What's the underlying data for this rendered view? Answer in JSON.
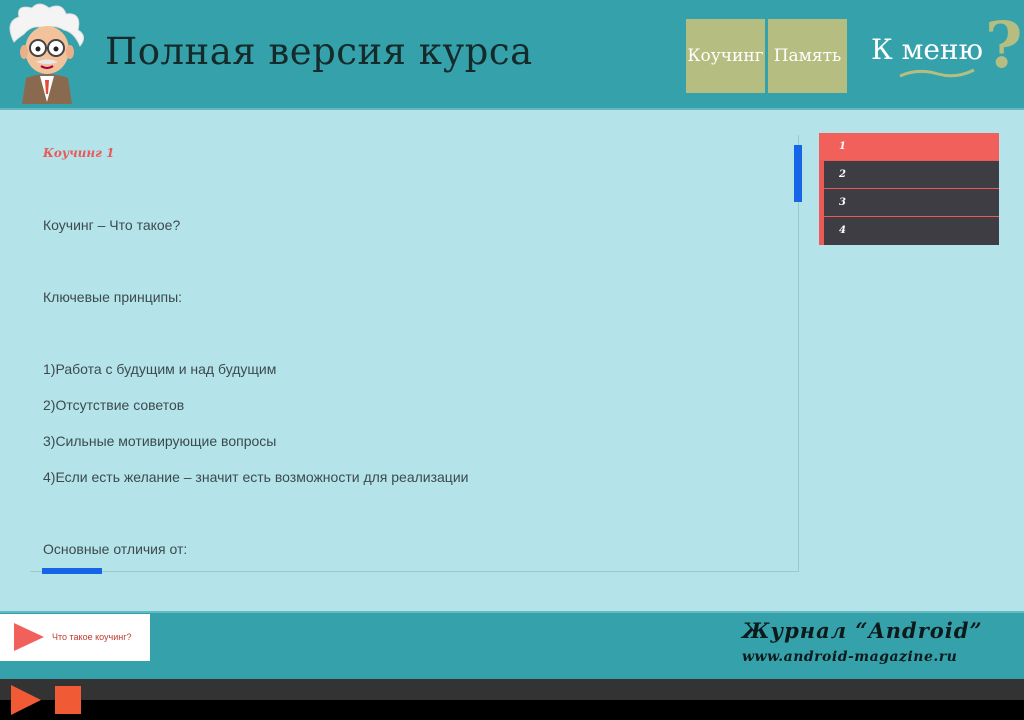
{
  "header": {
    "title": "Полная версия курса",
    "nav": {
      "coaching_label": "Коучинг",
      "memory_label": "Память"
    },
    "to_menu_label": "К меню",
    "help_label": "?"
  },
  "content": {
    "paragraphs": [
      "Коучинг 1",
      "Коучинг – Что такое?",
      "Ключевые принципы:",
      "1)Работа с будущим и над будущим",
      "2)Отсутствие советов",
      "3)Сильные мотивирующие вопросы",
      "4)Если есть желание – значит есть возможности для реализации",
      "Основные отличия от:"
    ]
  },
  "sidelist": {
    "items": [
      "1",
      "2",
      "3",
      "4"
    ],
    "active_index": 0
  },
  "footer": {
    "audio_label": "Что такое коучинг?",
    "magazine_line1": "Журнал “Android”",
    "magazine_line2": "www.android-magazine.ru"
  },
  "colors": {
    "header_bg": "#35a2ab",
    "content_bg": "#b4e4ea",
    "nav_button": "#b5be80",
    "accent_red": "#f2605c",
    "scroll_blue": "#1565e6",
    "player_orange": "#f05a35"
  },
  "icons": {
    "mascot": "einstein-mascot-icon",
    "help": "question-mark-icon",
    "audio_play": "play-icon",
    "player_play": "play-icon",
    "player_stop": "stop-icon"
  }
}
